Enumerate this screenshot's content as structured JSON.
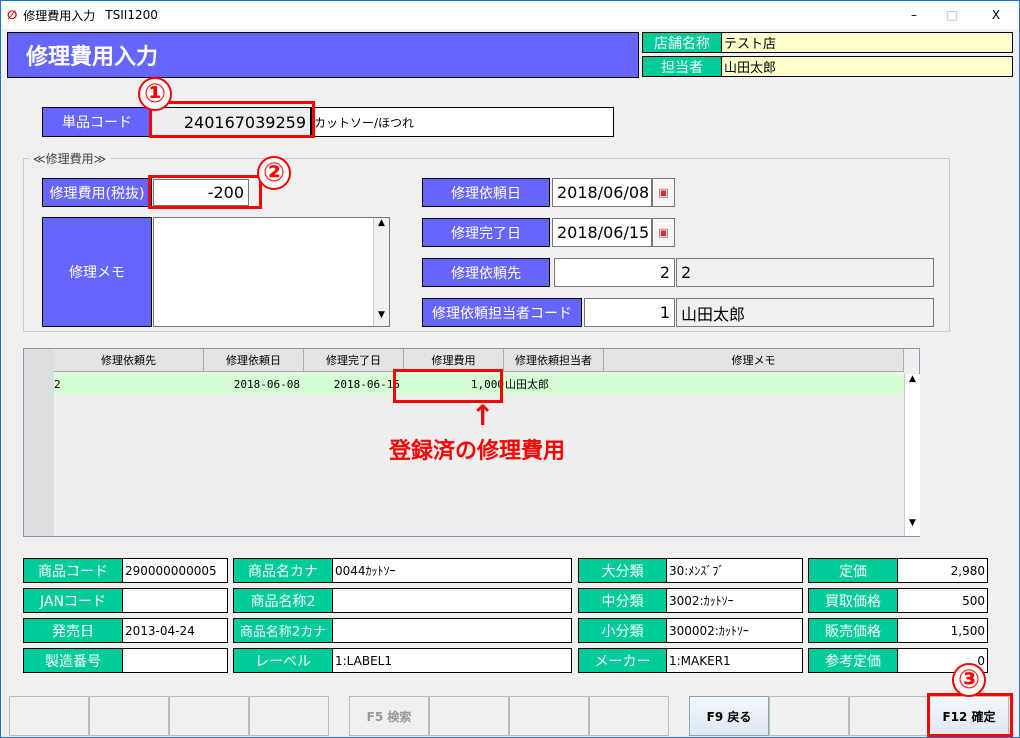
{
  "window": {
    "title": "修理費用入力",
    "code": "TSII1200",
    "controls": {
      "minimize": "–",
      "maximize": "□",
      "close": "X"
    }
  },
  "header": {
    "title": "修理費用入力",
    "store_label": "店舗名称",
    "store_value": "テスト店",
    "staff_label": "担当者",
    "staff_value": "山田太郎"
  },
  "item": {
    "label": "単品コード",
    "code": "240167039259",
    "name": "カットソー/ほつれ"
  },
  "repair": {
    "group": "≪修理費用≫",
    "cost_label": "修理費用(税抜)",
    "cost": "-200",
    "memo_label": "修理メモ",
    "memo": "",
    "request_date_label": "修理依頼日",
    "request_date": "2018/06/08",
    "complete_date_label": "修理完了日",
    "complete_date": "2018/06/15",
    "vendor_label": "修理依頼先",
    "vendor_code": "2",
    "vendor_name": "2",
    "person_label": "修理依頼担当者コード",
    "person_code": "1",
    "person_name": "山田太郎"
  },
  "grid": {
    "columns": [
      "修理依頼先",
      "修理依頼日",
      "修理完了日",
      "修理費用",
      "修理依頼担当者",
      "修理メモ"
    ],
    "rows": [
      [
        "2",
        "2018-06-08",
        "2018-06-15",
        "1,000",
        "山田太郎",
        ""
      ]
    ],
    "row_color": "#d4ffd4"
  },
  "annotations": {
    "n1": "①",
    "n2": "②",
    "n3": "③",
    "note": "登録済の修理費用",
    "arrow": "↑",
    "color": "#ff0000"
  },
  "product": {
    "code_label": "商品コード",
    "code": "290000000005",
    "jan_label": "JANコード",
    "jan": "",
    "release_label": "発売日",
    "release": "2013-04-24",
    "serial_label": "製造番号",
    "serial": "",
    "kana_label": "商品名カナ",
    "kana": "0044ｶｯﾄｿｰ",
    "name2_label": "商品名称2",
    "name2": "",
    "name2kana_label": "商品名称2カナ",
    "name2kana": "",
    "level_label": "レーベル",
    "level": "1:LABEL1",
    "cat1_label": "大分類",
    "cat1": "30:ﾒﾝｽﾞﾌﾞ",
    "cat2_label": "中分類",
    "cat2": "3002:ｶｯﾄｿｰ",
    "cat3_label": "小分類",
    "cat3": "300002:ｶｯﾄｿｰ",
    "maker_label": "メーカー",
    "maker": "1:MAKER1",
    "list_label": "定価",
    "list": "2,980",
    "buy_label": "買取価格",
    "buy": "500",
    "sell_label": "販売価格",
    "sell": "1,500",
    "ref_label": "参考定価",
    "ref": "0"
  },
  "fkeys": [
    "",
    "",
    "",
    "",
    "F5 検索",
    "",
    "",
    "",
    "F9 戻る",
    "",
    "",
    "F12 確定"
  ],
  "colors": {
    "header": "#6666ff",
    "label_green": "#00cc99",
    "highlight": "#ffffcc"
  }
}
